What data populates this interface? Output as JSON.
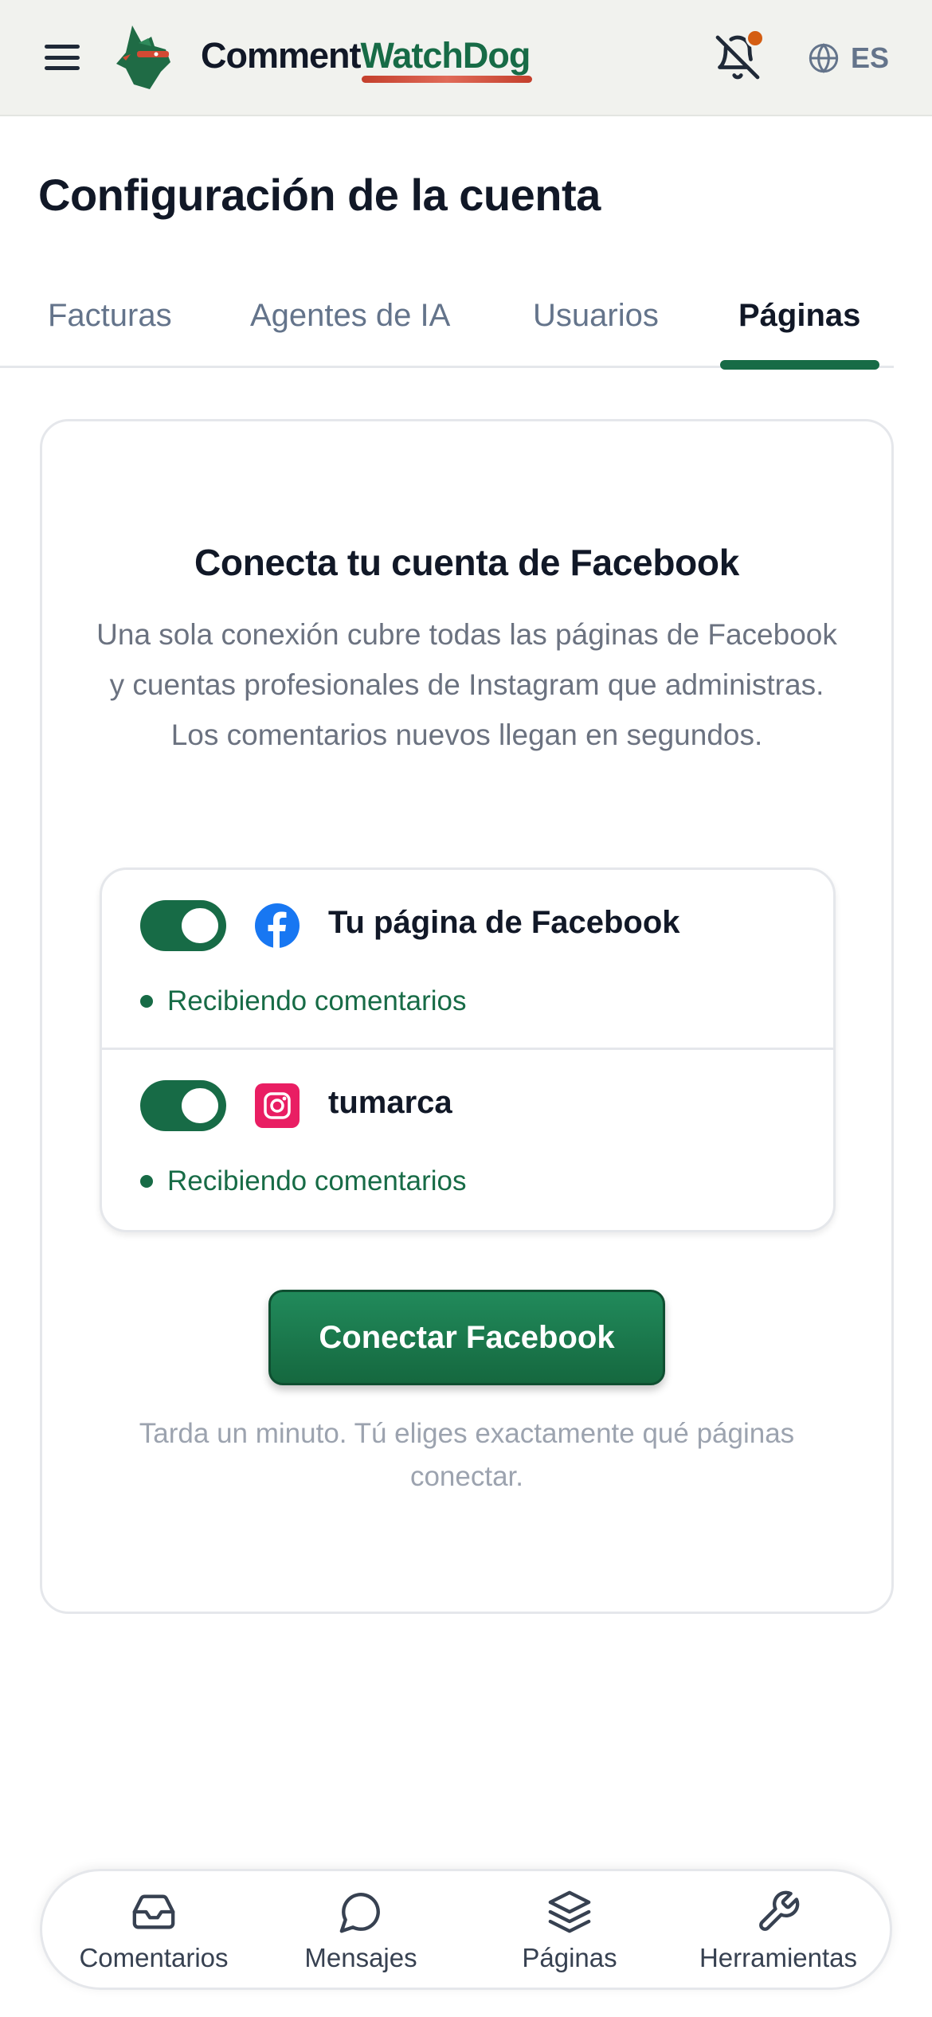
{
  "header": {
    "brand_part1": "Comment",
    "brand_part2": "WatchDog",
    "language": "ES",
    "icons": {
      "menu": "hamburger-menu-icon",
      "logo": "watchdog-logo",
      "notifications": "bell-off-icon",
      "language": "globe-icon"
    },
    "notification_dot_color": "#d45d12"
  },
  "page": {
    "title": "Configuración de la cuenta"
  },
  "tabs": [
    {
      "label": "Facturas"
    },
    {
      "label": "Agentes de IA"
    },
    {
      "label": "Usuarios"
    },
    {
      "label": "Páginas",
      "active": true
    }
  ],
  "card": {
    "title": "Conecta tu cuenta de Facebook",
    "description": "Una sola conexión cubre todas las páginas de Facebook y cuentas profesionales de Instagram que administras. Los comentarios nuevos llegan en segundos.",
    "connections": [
      {
        "name": "Tu página de Facebook",
        "status": "Recibiendo comentarios",
        "enabled": true,
        "icon": "facebook-icon"
      },
      {
        "name": "tumarca",
        "status": "Recibiendo comentarios",
        "enabled": true,
        "icon": "instagram-icon"
      }
    ],
    "button_label": "Conectar Facebook",
    "footnote": "Tarda un minuto. Tú eliges exactamente qué páginas conectar."
  },
  "bottom_nav": [
    {
      "label": "Comentarios",
      "icon": "inbox-icon"
    },
    {
      "label": "Mensajes",
      "icon": "chat-bubble-icon"
    },
    {
      "label": "Páginas",
      "icon": "layers-icon"
    },
    {
      "label": "Herramientas",
      "icon": "wrench-icon"
    }
  ],
  "colors": {
    "accent": "#176b46",
    "header_bg": "#f1f2ee",
    "brand_underline": "#c43f2c",
    "instagram": "#e91e63",
    "facebook": "#1877f2"
  }
}
